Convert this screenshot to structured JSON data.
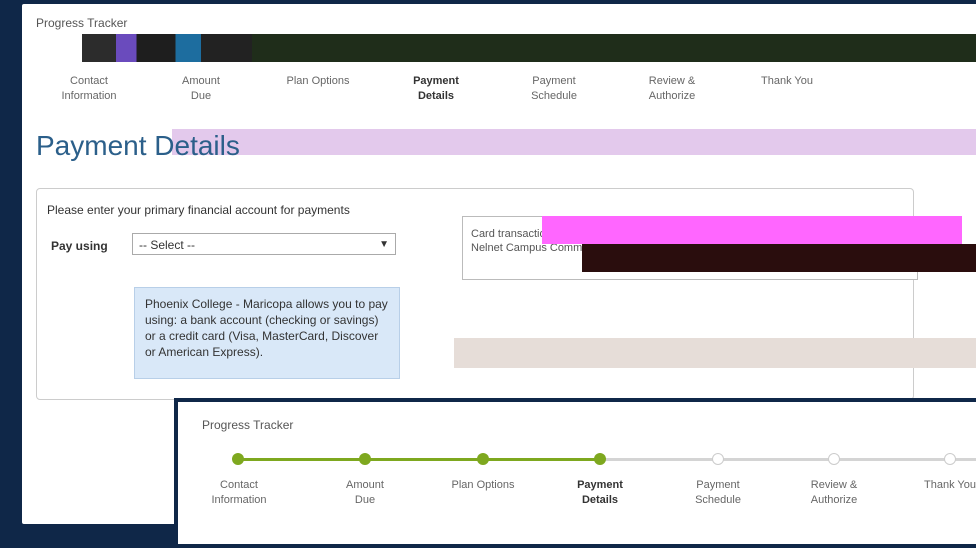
{
  "tracker": {
    "title": "Progress Tracker",
    "steps": [
      {
        "line1": "Contact",
        "line2": "Information",
        "state": "done"
      },
      {
        "line1": "Amount",
        "line2": "Due",
        "state": "done"
      },
      {
        "line1": "Plan Options",
        "line2": "",
        "state": "done"
      },
      {
        "line1": "Payment",
        "line2": "Details",
        "state": "current"
      },
      {
        "line1": "Payment",
        "line2": "Schedule",
        "state": "todo"
      },
      {
        "line1": "Review &",
        "line2": "Authorize",
        "state": "todo"
      },
      {
        "line1": "Thank You",
        "line2": "",
        "state": "todo"
      }
    ],
    "accent_color": "#7ea81f"
  },
  "page": {
    "heading": "Payment Details"
  },
  "form": {
    "title": "Please enter your primary financial account for payments",
    "pay_using_label": "Pay using",
    "select_value": "-- Select --",
    "info_text": "Phoenix College - Maricopa allows you to pay using: a bank account (checking or savings) or a credit card (Visa, MasterCard, Discover or American Express)."
  },
  "side_note": {
    "line1": "Card transactions...",
    "line2": "Nelnet Campus Commerce..."
  },
  "overlay": {
    "title": "Progress Tracker",
    "steps": [
      {
        "line1": "Contact",
        "line2": "Information"
      },
      {
        "line1": "Amount",
        "line2": "Due"
      },
      {
        "line1": "Plan Options",
        "line2": ""
      },
      {
        "line1": "Payment",
        "line2": "Details"
      },
      {
        "line1": "Payment",
        "line2": "Schedule"
      },
      {
        "line1": "Review &",
        "line2": "Authorize"
      },
      {
        "line1": "Thank You",
        "line2": ""
      }
    ]
  }
}
